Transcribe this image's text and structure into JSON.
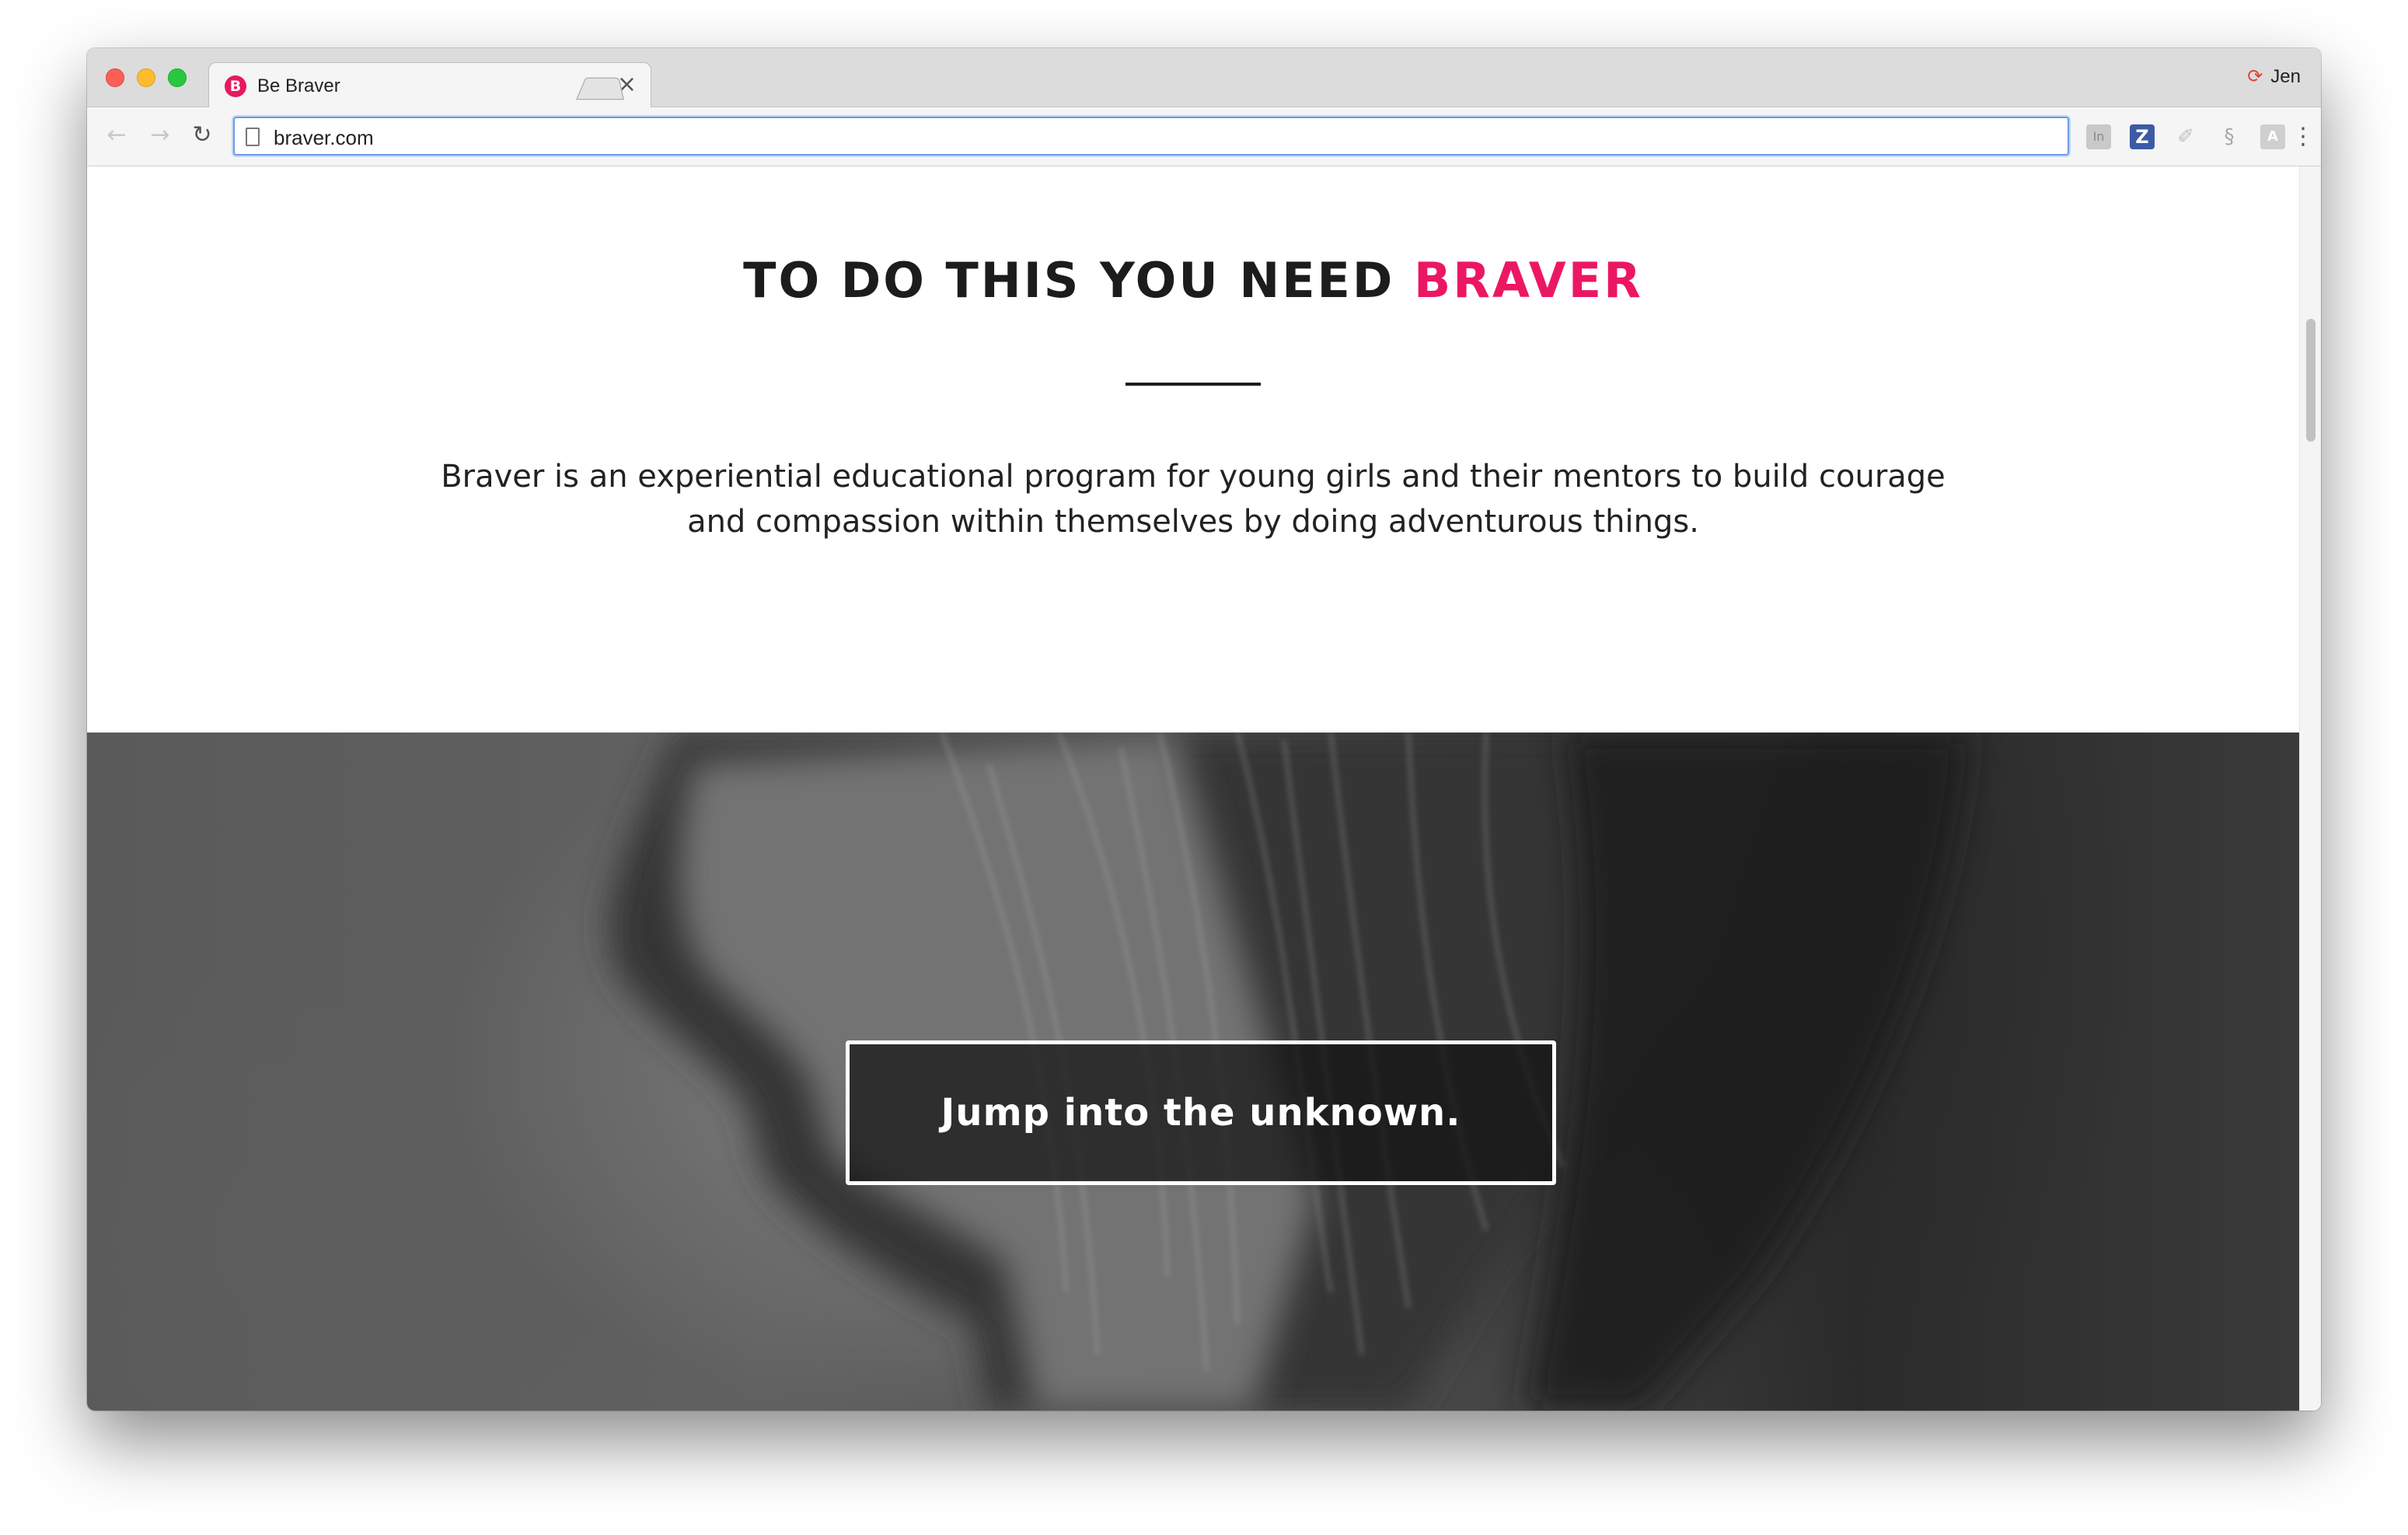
{
  "browser": {
    "tab": {
      "title": "Be Braver",
      "favicon_letter": "B",
      "close_glyph": "×"
    },
    "profile": {
      "name": "Jen",
      "icon": "profile-sync-icon",
      "icon_glyph": "⟳"
    },
    "nav": {
      "back_glyph": "←",
      "forward_glyph": "→",
      "reload_glyph": "↻",
      "menu_glyph": "⋮"
    },
    "address": {
      "url": "braver.com"
    },
    "extensions": [
      {
        "name": "in-extension-icon",
        "glyph": "In"
      },
      {
        "name": "z-extension-icon",
        "glyph": "Z"
      },
      {
        "name": "pen-extension-icon",
        "glyph": "✐"
      },
      {
        "name": "s-extension-icon",
        "glyph": "§"
      },
      {
        "name": "tile-extension-icon",
        "glyph": "A"
      }
    ]
  },
  "page": {
    "headline": {
      "text": "TO DO THIS YOU NEED ",
      "accent": "BRAVER"
    },
    "intro": "Braver is an experiential educational program for young girls and their mentors to build courage and compassion within themselves by doing adventurous things.",
    "hero": {
      "cta_label": "Jump into the unknown."
    }
  },
  "colors": {
    "accent": "#ec1763",
    "text": "#1c1c1c",
    "favicon": "#e8195e",
    "focus_ring": "#6d9ae6"
  }
}
